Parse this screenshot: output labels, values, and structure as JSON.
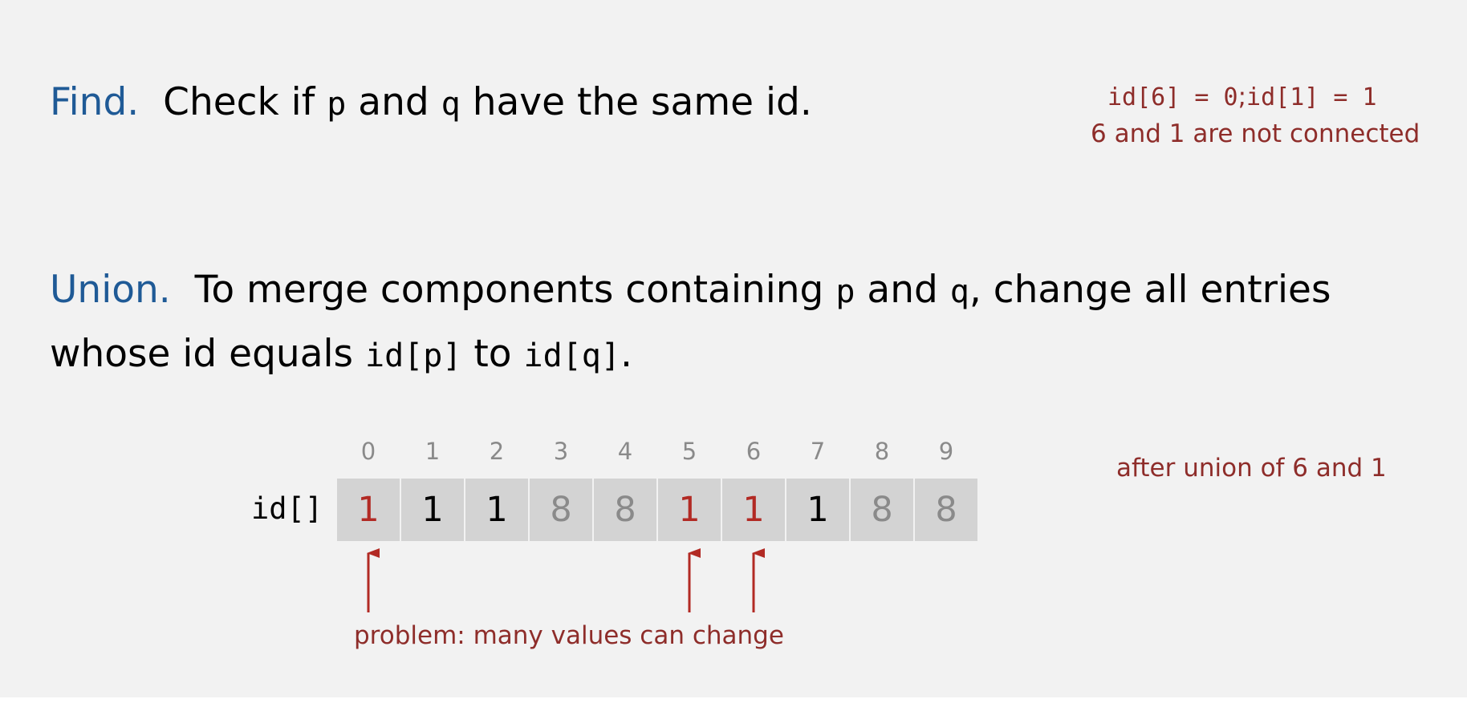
{
  "find": {
    "label": "Find.",
    "text_1": "Check if",
    "var_p": "p",
    "text_2": "and",
    "var_q": "q",
    "text_3": "have the same id."
  },
  "find_note": {
    "line_1_a": "id[6] = 0",
    "line_1_sep": ";",
    "line_1_b": "id[1] = 1",
    "line_2": "6 and 1 are not connected"
  },
  "union": {
    "label": "Union.",
    "text_1": "To merge components containing",
    "var_p": "p",
    "text_2": "and",
    "var_q": "q",
    "text_3": ", change all entries",
    "text_4": "whose id equals",
    "code_idp": "id[p]",
    "text_5": "to",
    "code_idq": "id[q]",
    "text_6": "."
  },
  "array": {
    "name": "id[]",
    "indices": [
      "0",
      "1",
      "2",
      "3",
      "4",
      "5",
      "6",
      "7",
      "8",
      "9"
    ],
    "values": [
      "1",
      "1",
      "1",
      "8",
      "8",
      "1",
      "1",
      "1",
      "8",
      "8"
    ],
    "states": [
      "changed",
      "same",
      "same",
      "other",
      "other",
      "changed",
      "changed",
      "same",
      "other",
      "other"
    ]
  },
  "after_note": "after union of 6 and 1",
  "problem_note": "problem: many values can change",
  "colors": {
    "background": "#f2f2f2",
    "label_blue": "#1f5a96",
    "note_red": "#8e2d2a",
    "arrow_red": "#b22a24",
    "cell_gray": "#d3d3d3",
    "index_gray": "#8a8a8a"
  }
}
